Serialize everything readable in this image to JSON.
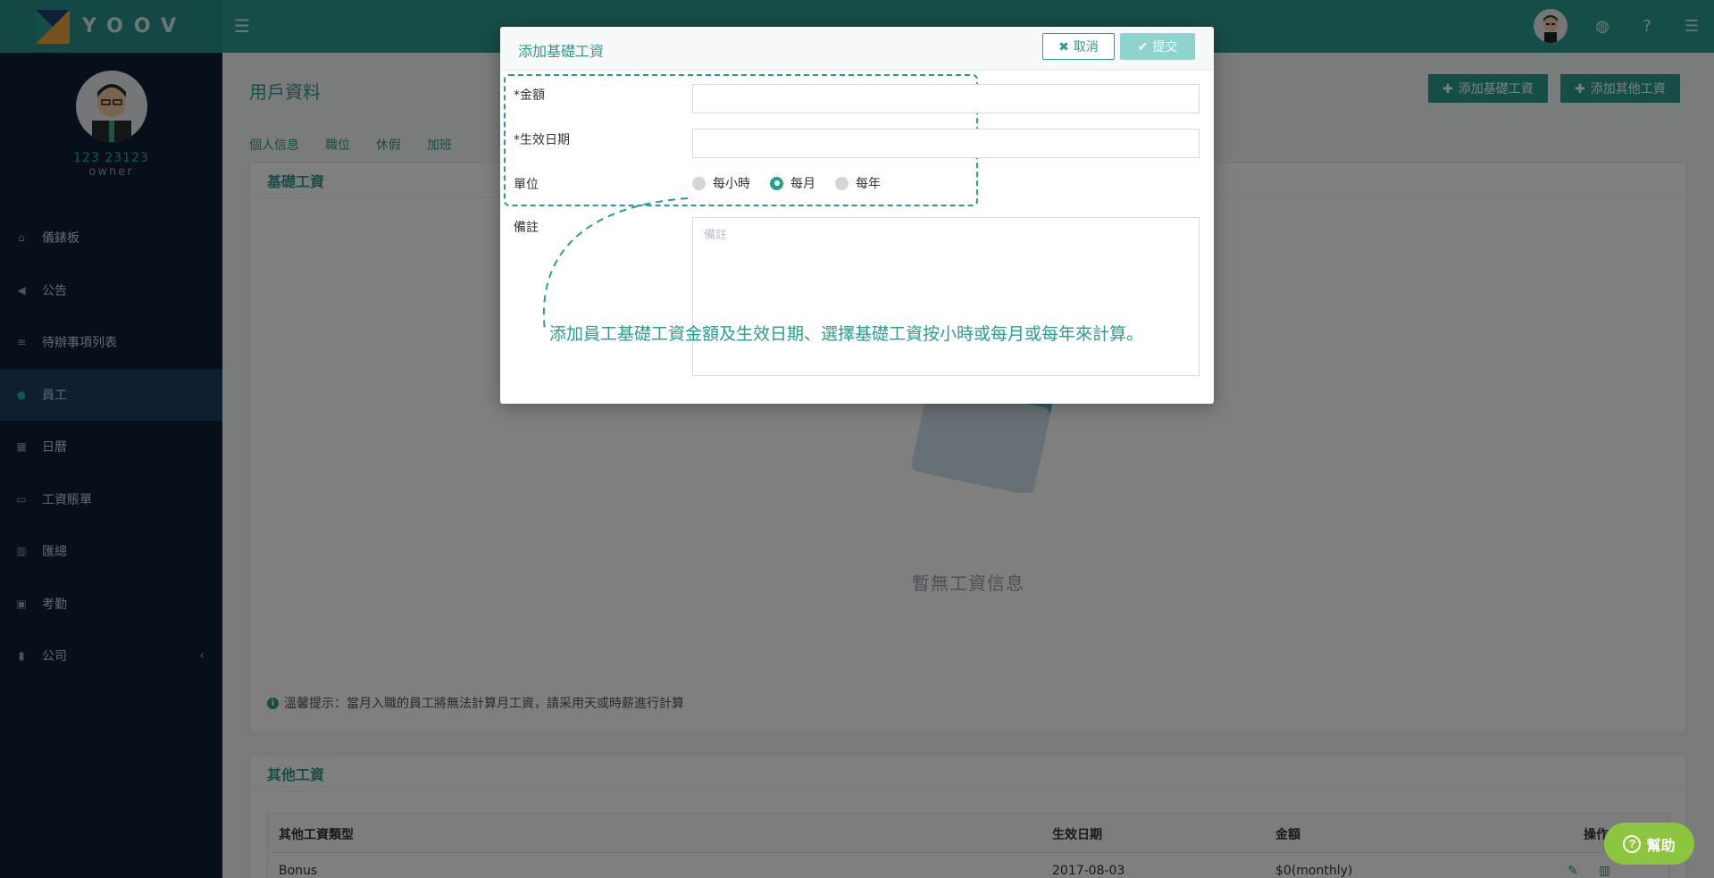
{
  "brand": {
    "name": "YOOV"
  },
  "topbar": {
    "icons": [
      "menu-icon",
      "globe-icon",
      "question-icon",
      "bars-icon"
    ]
  },
  "profile": {
    "name": "123 23123",
    "role": "owner"
  },
  "sidebar": {
    "items": [
      {
        "label": "儀錶板",
        "icon": "home-icon"
      },
      {
        "label": "公告",
        "icon": "megaphone-icon"
      },
      {
        "label": "待辦事項列表",
        "icon": "list-icon"
      },
      {
        "label": "員工",
        "icon": "users-icon",
        "active": true
      },
      {
        "label": "日曆",
        "icon": "calendar-icon"
      },
      {
        "label": "工資賬單",
        "icon": "money-icon"
      },
      {
        "label": "匯總",
        "icon": "bar-chart-icon"
      },
      {
        "label": "考勤",
        "icon": "attendance-icon"
      },
      {
        "label": "公司",
        "icon": "building-icon"
      }
    ]
  },
  "page": {
    "title": "用戶資料",
    "add_basic_salary": "添加基礎工資",
    "add_other_salary": "添加其他工資",
    "tabs": [
      "個人信息",
      "職位",
      "休假",
      "加班"
    ]
  },
  "basic_salary_panel": {
    "title": "基礎工資",
    "empty_text": "暫無工資信息",
    "tip": "溫馨提示：當月入職的員工將無法計算月工資，請采用天或時薪進行計算"
  },
  "other_salary_panel": {
    "title": "其他工資",
    "columns": {
      "type": "其他工資類型",
      "effective_date": "生效日期",
      "amount": "金額",
      "actions": "操作"
    },
    "rows": [
      {
        "type": "Bonus",
        "effective_date": "2017-08-03",
        "amount": "$0(monthly)"
      }
    ]
  },
  "help": {
    "label": "幫助"
  },
  "modal": {
    "title": "添加基礎工資",
    "cancel": "取消",
    "submit": "提交",
    "amount_label": "*金額",
    "amount_value": "",
    "date_label": "*生效日期",
    "date_value": "",
    "unit_label": "單位",
    "units": [
      {
        "label": "每小時",
        "checked": false
      },
      {
        "label": "每月",
        "checked": true
      },
      {
        "label": "每年",
        "checked": false
      }
    ],
    "remark_label": "備註",
    "remark_placeholder": "備註",
    "annotation": "添加員工基礎工資金額及生效日期、選擇基礎工資按小時或每月或每年來計算。"
  },
  "colors": {
    "accent": "#2a9d8f",
    "sidebar": "#0e1e35",
    "help": "#8cc63f"
  }
}
